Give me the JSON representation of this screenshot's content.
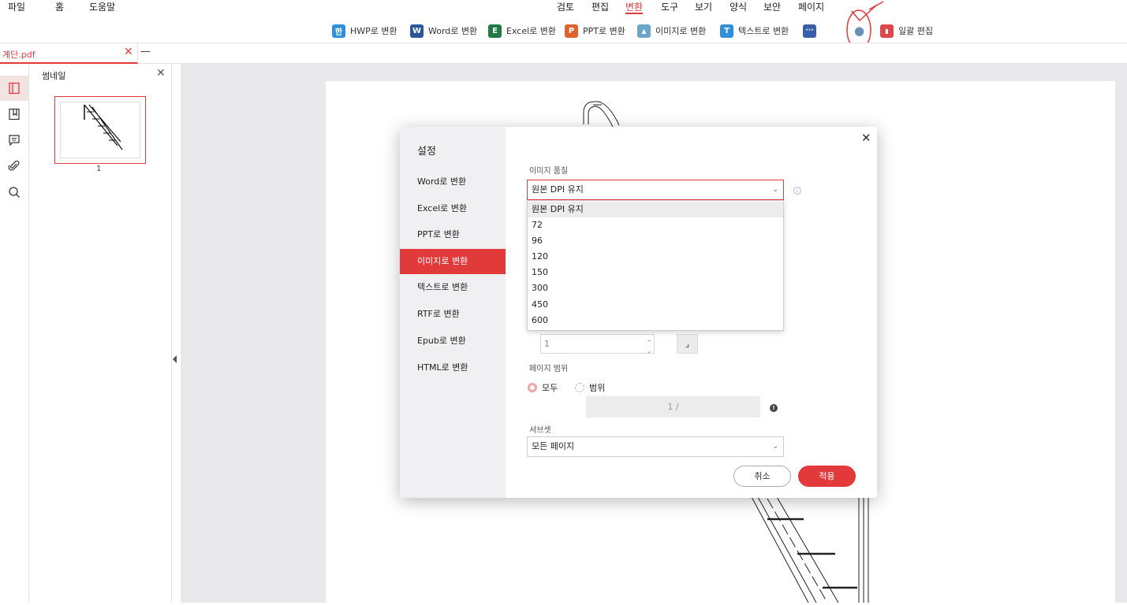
{
  "menu": {
    "left": [
      "파일",
      "홈",
      "도움말"
    ],
    "tabs": [
      "검토",
      "편집",
      "변환",
      "도구",
      "보기",
      "양식",
      "보안",
      "페이지"
    ],
    "active_tab": "변환"
  },
  "toolbar": {
    "buttons": [
      {
        "label": "HWP로 변환",
        "icon": "hwp-icon",
        "icon_char": "한",
        "color": "#2f8fd8"
      },
      {
        "label": "Word로 변환",
        "icon": "word-icon",
        "icon_char": "W",
        "color": "#2b579a"
      },
      {
        "label": "Excel로 변환",
        "icon": "excel-icon",
        "icon_char": "E",
        "color": "#1f7a45"
      },
      {
        "label": "PPT로 변환",
        "icon": "ppt-icon",
        "icon_char": "P",
        "color": "#e0622e"
      },
      {
        "label": "이미지로 변환",
        "icon": "image-icon",
        "icon_char": "▲",
        "color": "#6aa6c9"
      },
      {
        "label": "텍스트로 변환",
        "icon": "text-icon",
        "icon_char": "T",
        "color": "#2f8fd8"
      },
      {
        "label": "",
        "icon": "more-icon",
        "icon_char": "···",
        "color": "#3a5fa8"
      },
      {
        "label": "",
        "icon": "settings-icon",
        "icon_char": "●",
        "color": "#6a8fb5"
      },
      {
        "label": "일괄 편집",
        "icon": "batch-edit-icon",
        "icon_char": "▮",
        "color": "#e0474c"
      }
    ]
  },
  "doc_tab": {
    "title": "계단.pdf",
    "close": "✕",
    "minimize": "—"
  },
  "rail": {
    "icons": [
      "thumbnail-panel-icon",
      "bookmark-icon",
      "comment-icon",
      "attachment-icon",
      "search-icon"
    ]
  },
  "thumbnail_panel": {
    "title": "썸네일",
    "close": "✕",
    "page_number": "1"
  },
  "dialog": {
    "title": "설정",
    "close": "✕",
    "nav": [
      "Word로 변환",
      "Excel로 변환",
      "PPT로 변환",
      "이미지로 변환",
      "텍스트로 변환",
      "RTF로 변환",
      "Epub로 변환",
      "HTML로 변환"
    ],
    "active_nav": "이미지로 변환",
    "image_quality_label": "이미지 품질",
    "image_quality_value": "원본 DPI 유지",
    "dpi_options": [
      "원본 DPI 유지",
      "72",
      "96",
      "120",
      "150",
      "300",
      "450",
      "600"
    ],
    "spin_value": "1",
    "page_range_label": "페이지 범위",
    "radio_all": "모두",
    "radio_range": "범위",
    "range_value": "1 /",
    "subset_label": "서브셋",
    "subset_value": "모든 페이지",
    "cancel": "취소",
    "apply": "적용"
  },
  "colors": {
    "accent": "#e23a3a"
  }
}
